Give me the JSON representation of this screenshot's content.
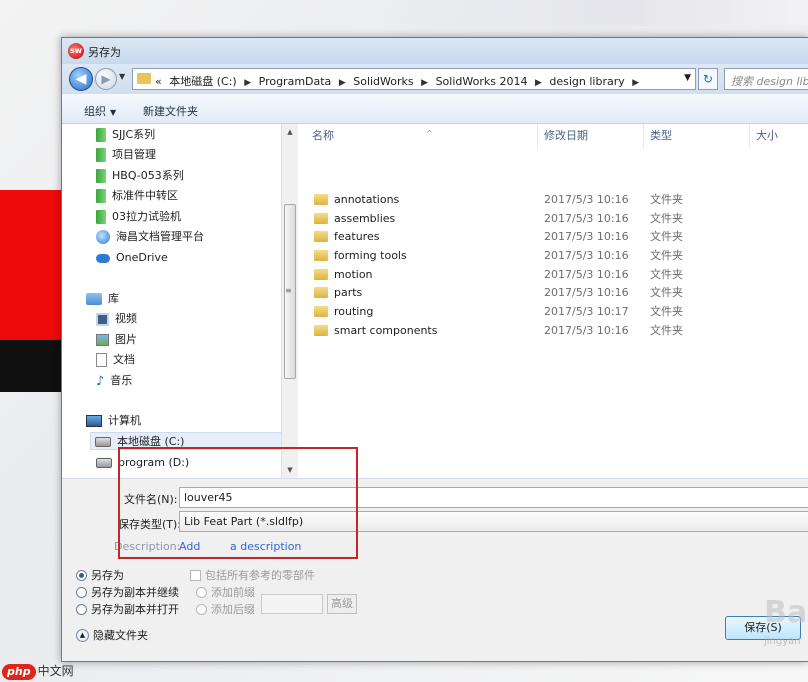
{
  "window": {
    "title": "另存为"
  },
  "address": {
    "crumbs": [
      "«",
      "本地磁盘 (C:)",
      "ProgramData",
      "SolidWorks",
      "SolidWorks 2014",
      "design library"
    ],
    "search_placeholder": "搜索 design library"
  },
  "toolbar": {
    "organize_label": "组织",
    "new_folder_label": "新建文件夹"
  },
  "nav": {
    "favorites": [
      "SJJC系列",
      "项目管理",
      "HBQ-053系列",
      "标准件中转区",
      "03拉力试验机"
    ],
    "app_item": "海昌文档管理平台",
    "onedrive": "OneDrive",
    "library_header": "库",
    "libraries": [
      "视频",
      "图片",
      "文档",
      "音乐"
    ],
    "computer_header": "计算机",
    "drives": [
      "本地磁盘 (C:)",
      "program (D:)"
    ]
  },
  "columns": {
    "name": "名称",
    "date": "修改日期",
    "type": "类型",
    "size": "大小"
  },
  "files": [
    {
      "name": "annotations",
      "date": "2017/5/3 10:16",
      "type": "文件夹"
    },
    {
      "name": "assemblies",
      "date": "2017/5/3 10:16",
      "type": "文件夹"
    },
    {
      "name": "features",
      "date": "2017/5/3 10:16",
      "type": "文件夹"
    },
    {
      "name": "forming tools",
      "date": "2017/5/3 10:16",
      "type": "文件夹"
    },
    {
      "name": "motion",
      "date": "2017/5/3 10:16",
      "type": "文件夹"
    },
    {
      "name": "parts",
      "date": "2017/5/3 10:16",
      "type": "文件夹"
    },
    {
      "name": "routing",
      "date": "2017/5/3 10:17",
      "type": "文件夹"
    },
    {
      "name": "smart components",
      "date": "2017/5/3 10:16",
      "type": "文件夹"
    }
  ],
  "form": {
    "filename_label": "文件名(N):",
    "filename_value": "louver45",
    "filetype_label": "保存类型(T):",
    "filetype_value": "Lib Feat Part (*.sldlfp)",
    "description_label": "Description:",
    "description_link_1": "Add",
    "description_link_2": "a description"
  },
  "options": {
    "save_as": "另存为",
    "save_copy_continue": "另存为副本并继续",
    "save_copy_open": "另存为副本并打开",
    "include_refs": "包括所有参考的零部件",
    "add_prefix": "添加前缀",
    "add_suffix": "添加后缀",
    "advanced": "高级",
    "hide_folders": "隐藏文件夹",
    "save_button": "保存(S)"
  },
  "watermarks": {
    "php": "php",
    "cn": "中文网",
    "ba": "Ba",
    "ba_small": "jingyan"
  }
}
